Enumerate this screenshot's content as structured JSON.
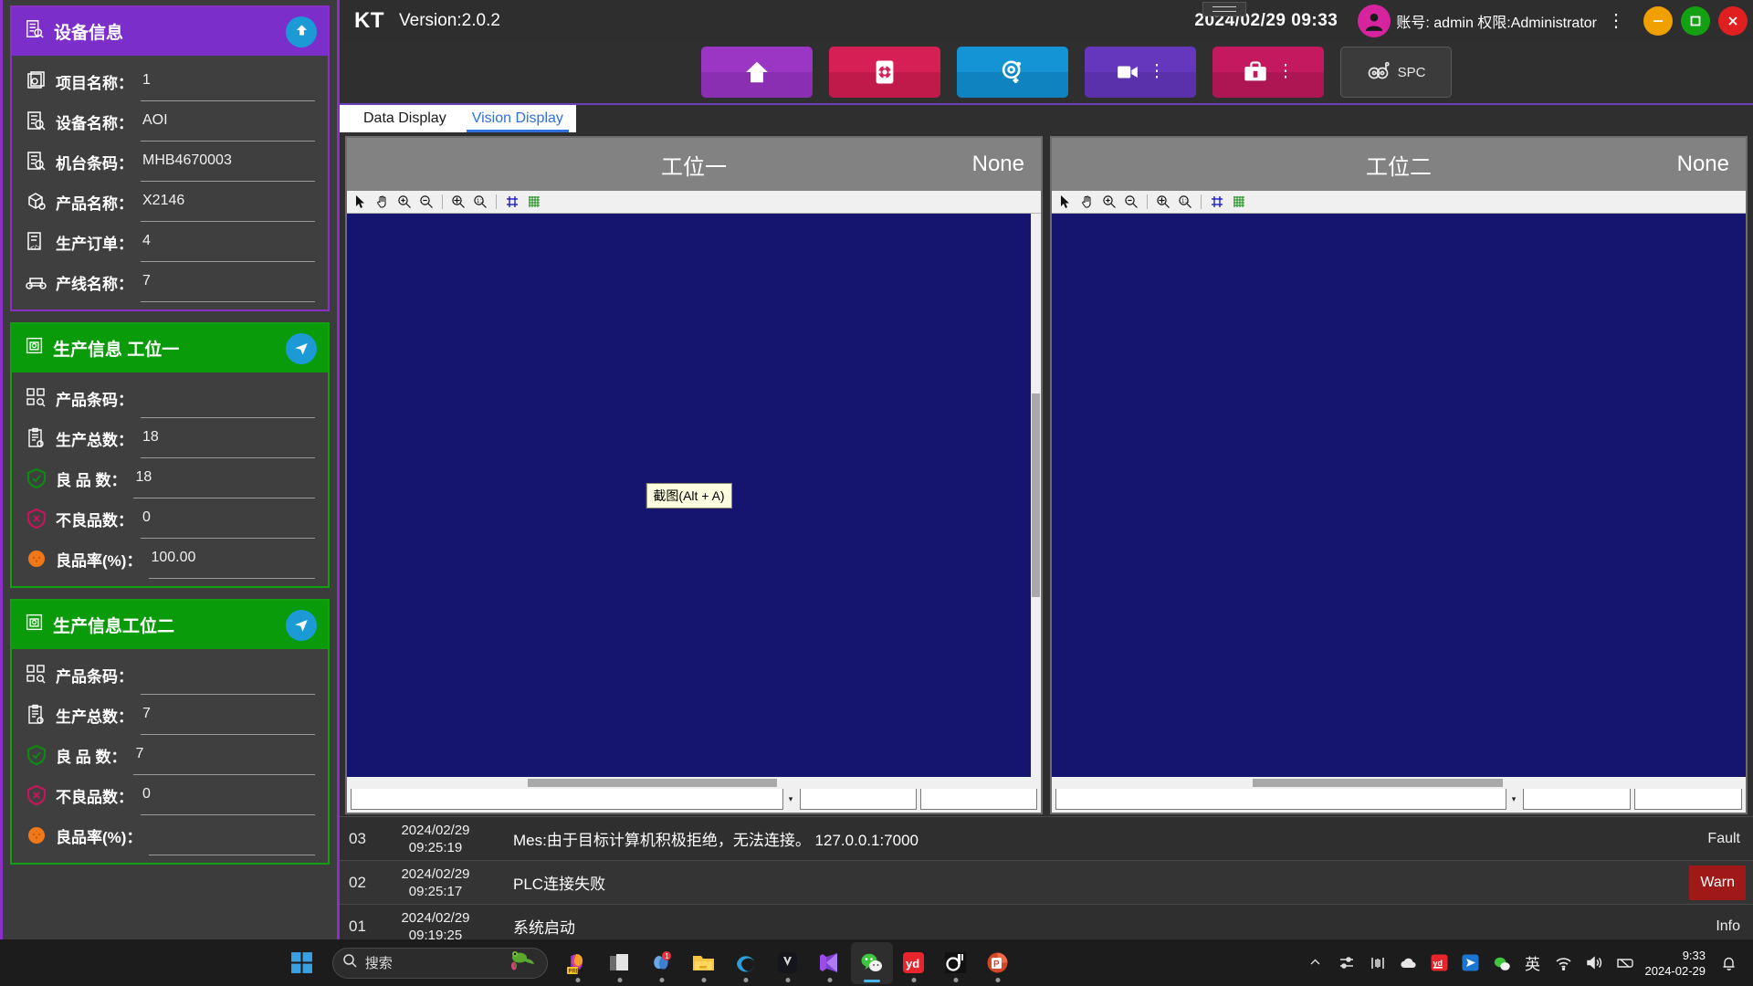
{
  "window": {
    "brand": "KT",
    "version": "Version:2.0.2",
    "clock": "2024/02/29  09:33",
    "account": "账号: admin 权限:Administrator",
    "kebab": "⋮",
    "min_label": "−",
    "max_label": "▭",
    "close_label": "✕"
  },
  "sidebar": {
    "device": {
      "title": "设备信息",
      "rows": [
        {
          "icon": "project-icon",
          "label": "项目名称：",
          "value": "1"
        },
        {
          "icon": "device-icon",
          "label": "设备名称：",
          "value": "AOI"
        },
        {
          "icon": "barcode-icon",
          "label": "机台条码：",
          "value": "MHB4670003"
        },
        {
          "icon": "product-icon",
          "label": "产品名称：",
          "value": "X2146"
        },
        {
          "icon": "order-icon",
          "label": "生产订单：",
          "value": "4"
        },
        {
          "icon": "line-icon",
          "label": "产线名称：",
          "value": "7"
        }
      ]
    },
    "station1": {
      "title": "生产信息 工位一",
      "rows": [
        {
          "icon": "qrcode-icon",
          "label": "产品条码：",
          "value": ""
        },
        {
          "icon": "clipboard-icon",
          "label": "生产总数：",
          "value": "18"
        },
        {
          "icon": "shield-ok-icon",
          "label": "良 品 数：",
          "value": "18"
        },
        {
          "icon": "shield-bad-icon",
          "label": "不良品数：",
          "value": "0"
        },
        {
          "icon": "gear-orange-icon",
          "label": "良品率(%)：",
          "value": "100.00"
        }
      ]
    },
    "station2": {
      "title": "生产信息工位二",
      "rows": [
        {
          "icon": "qrcode-icon",
          "label": "产品条码：",
          "value": ""
        },
        {
          "icon": "clipboard-icon",
          "label": "生产总数：",
          "value": "7"
        },
        {
          "icon": "shield-ok-icon",
          "label": "良 品 数：",
          "value": "7"
        },
        {
          "icon": "shield-bad-icon",
          "label": "不良品数：",
          "value": "0"
        },
        {
          "icon": "gear-orange-icon",
          "label": "良品率(%)：",
          "value": ""
        }
      ]
    }
  },
  "toolbar": {
    "buttons": [
      {
        "name": "home-button",
        "icon": "home-icon",
        "label": "",
        "menu": false
      },
      {
        "name": "settings-button",
        "icon": "gear-icon",
        "label": "",
        "menu": false
      },
      {
        "name": "vision-button",
        "icon": "eye-plus-icon",
        "label": "",
        "menu": false
      },
      {
        "name": "camera-button",
        "icon": "camera-icon",
        "label": "",
        "menu": true
      },
      {
        "name": "tools-button",
        "icon": "toolbox-icon",
        "label": "",
        "menu": true
      },
      {
        "name": "spc-button",
        "icon": "spc-icon",
        "label": "SPC",
        "menu": false
      }
    ],
    "dots": "⋮"
  },
  "tabs": [
    {
      "label": "Data Display",
      "active": false
    },
    {
      "label": "Vision Display",
      "active": true
    }
  ],
  "vision": {
    "panels": [
      {
        "title": "工位一",
        "status": "None",
        "tooltip": "截图(Alt + A)"
      },
      {
        "title": "工位二",
        "status": "None",
        "tooltip": ""
      }
    ],
    "tools": [
      "pointer-icon",
      "pan-icon",
      "zoom-in-icon",
      "zoom-out-icon",
      "zoom-region-icon",
      "zoom-fit-icon",
      "crosshair-icon",
      "grid-icon"
    ],
    "combo_arrow": "▾"
  },
  "log": {
    "rows": [
      {
        "idx": "03",
        "date": "2024/02/29",
        "time": "09:25:19",
        "msg": "Mes:由于目标计算机积极拒绝，无法连接。 127.0.0.1:7000",
        "level": "Fault",
        "style": "plain"
      },
      {
        "idx": "02",
        "date": "2024/02/29",
        "time": "09:25:17",
        "msg": "PLC连接失败",
        "level": "Warn",
        "style": "warn"
      },
      {
        "idx": "01",
        "date": "2024/02/29",
        "time": "09:19:25",
        "msg": "系统启动",
        "level": "Info",
        "style": "plain"
      }
    ]
  },
  "taskbar": {
    "search_placeholder": "搜索",
    "apps": [
      {
        "name": "start-button",
        "icon": "windows-icon"
      },
      {
        "name": "copilot-app",
        "icon": "copilot-icon",
        "badge": ""
      },
      {
        "name": "taskview-app",
        "icon": "task-view-icon",
        "badge": ""
      },
      {
        "name": "notes-app",
        "icon": "notes-icon",
        "badge": "1"
      },
      {
        "name": "explorer-app",
        "icon": "folder-icon",
        "badge": ""
      },
      {
        "name": "edge-app",
        "icon": "edge-icon",
        "badge": ""
      },
      {
        "name": "vision-app",
        "icon": "unity-icon",
        "badge": ""
      },
      {
        "name": "vs-app",
        "icon": "visual-studio-icon",
        "badge": ""
      },
      {
        "name": "wechat-app",
        "icon": "wechat-icon",
        "badge": ""
      },
      {
        "name": "youdao-app",
        "icon": "youdao-icon",
        "badge": ""
      },
      {
        "name": "tim-app",
        "icon": "tim-icon",
        "badge": ""
      },
      {
        "name": "powerpoint-app",
        "icon": "powerpoint-icon",
        "badge": ""
      }
    ],
    "tray": [
      {
        "name": "show-hidden-icons",
        "icon": "chevron-up-icon",
        "glyph": "⌃"
      },
      {
        "name": "network-adapter-icon",
        "icon": "network-icon",
        "glyph": ""
      },
      {
        "name": "monitor-tool-icon",
        "icon": "meter-icon",
        "glyph": ""
      },
      {
        "name": "onedrive-icon",
        "icon": "cloud-icon",
        "glyph": ""
      },
      {
        "name": "youdao-tray-icon",
        "icon": "youdao-icon",
        "glyph": ""
      },
      {
        "name": "blue-app-icon",
        "icon": "send-icon",
        "glyph": ""
      },
      {
        "name": "wechat-tray-icon",
        "icon": "wechat-icon",
        "glyph": ""
      },
      {
        "name": "ime-icon",
        "icon": "ime-icon",
        "glyph": "英"
      },
      {
        "name": "wifi-icon",
        "icon": "wifi-icon",
        "glyph": ""
      },
      {
        "name": "volume-icon",
        "icon": "speaker-icon",
        "glyph": ""
      },
      {
        "name": "battery-icon",
        "icon": "battery-icon",
        "glyph": ""
      }
    ],
    "clock_time": "9:33",
    "clock_date": "2024-02-29",
    "notification_icon": "bell-icon"
  },
  "colors": {
    "purple": "#8b2fc9",
    "green": "#0a9b0a",
    "accent_blue": "#2f6fe0",
    "warn_red": "#a01919"
  }
}
